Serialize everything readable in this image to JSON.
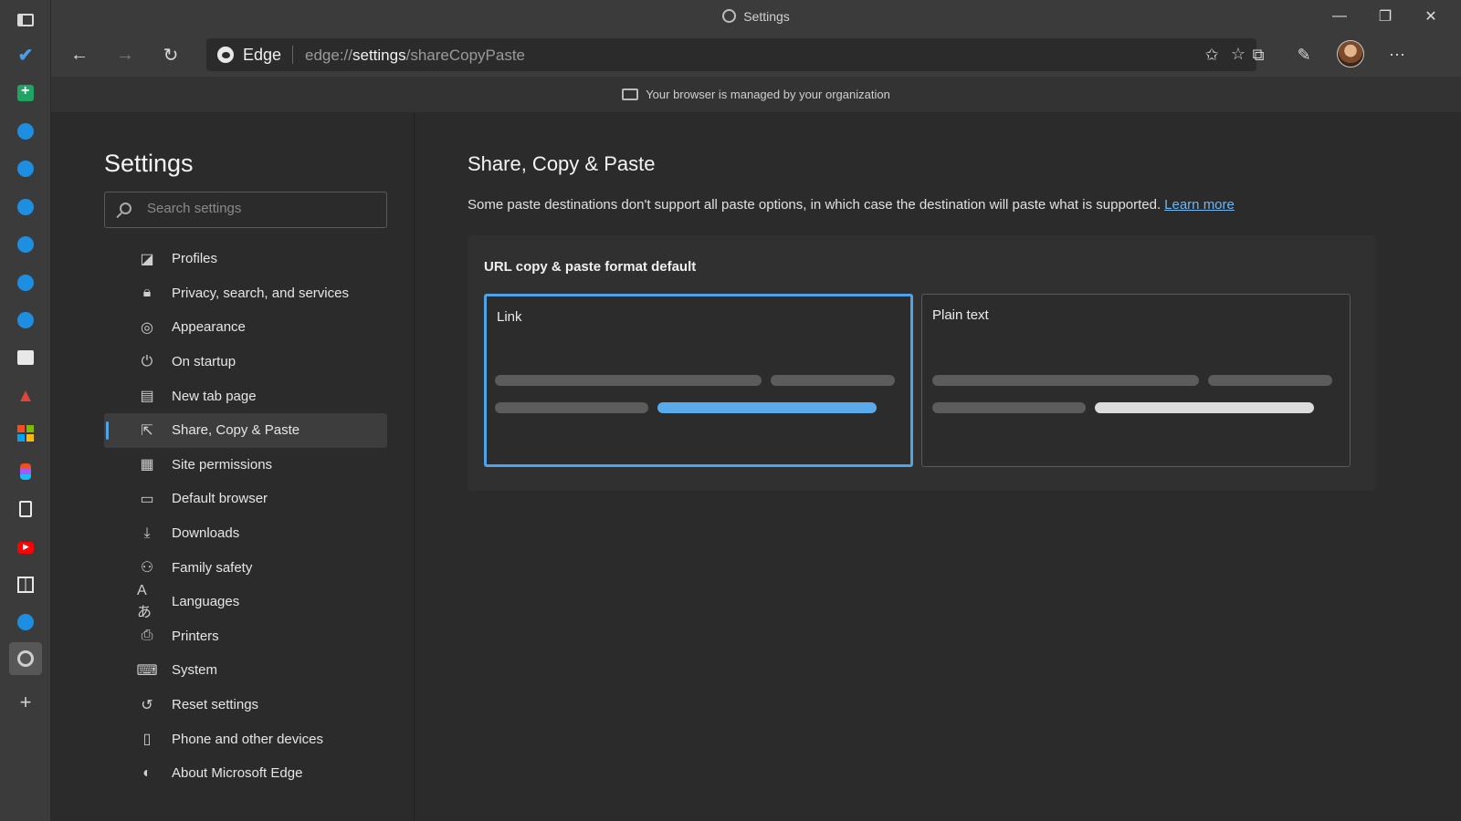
{
  "window": {
    "title": "Settings",
    "controls": [
      "minimize",
      "restore",
      "close"
    ]
  },
  "vertical_tabs": [
    {
      "icon": "tab-panel-icon",
      "color": "#d9d9d9"
    },
    {
      "icon": "todo-icon",
      "color": "#2f7fd8"
    },
    {
      "icon": "sheets-icon",
      "color": "#1fa463"
    },
    {
      "icon": "edge-tab-icon",
      "color": "#1e8ee0"
    },
    {
      "icon": "edge-tab-icon",
      "color": "#1e8ee0"
    },
    {
      "icon": "edge-tab-icon",
      "color": "#1e8ee0"
    },
    {
      "icon": "edge-tab-icon",
      "color": "#1e8ee0"
    },
    {
      "icon": "edge-tab-icon",
      "color": "#1e8ee0"
    },
    {
      "icon": "edge-tab-icon",
      "color": "#1e8ee0"
    },
    {
      "icon": "book-icon",
      "color": "#e8e8e8"
    },
    {
      "icon": "triangle-app-icon",
      "color": "#e0443a"
    },
    {
      "icon": "microsoft-logo-icon",
      "color": "#f25022"
    },
    {
      "icon": "figma-icon",
      "color": "#a259ff"
    },
    {
      "icon": "document-icon",
      "color": "#e8e8e8"
    },
    {
      "icon": "youtube-icon",
      "color": "#ff0000"
    },
    {
      "icon": "dashboard-icon",
      "color": "#e8e8e8"
    },
    {
      "icon": "edge-tab-icon",
      "color": "#1e8ee0"
    },
    {
      "icon": "settings-tab-icon",
      "color": "#cfcfcf",
      "active": true
    },
    {
      "icon": "new-tab-plus-icon",
      "color": "#cfcfcf"
    }
  ],
  "address_bar": {
    "brand": "Edge",
    "url_prefix": "edge://",
    "url_host": "settings",
    "url_path": "/shareCopyPaste"
  },
  "managed_banner": "Your browser is managed by your organization",
  "nav": {
    "title": "Settings",
    "search_placeholder": "Search settings",
    "items": [
      {
        "label": "Profiles",
        "icon": "profile-icon"
      },
      {
        "label": "Privacy, search, and services",
        "icon": "lock-icon"
      },
      {
        "label": "Appearance",
        "icon": "palette-icon"
      },
      {
        "label": "On startup",
        "icon": "power-icon"
      },
      {
        "label": "New tab page",
        "icon": "new-tab-page-icon"
      },
      {
        "label": "Share, Copy & Paste",
        "icon": "share-icon",
        "selected": true
      },
      {
        "label": "Site permissions",
        "icon": "site-permissions-icon"
      },
      {
        "label": "Default browser",
        "icon": "browser-window-icon"
      },
      {
        "label": "Downloads",
        "icon": "download-icon"
      },
      {
        "label": "Family safety",
        "icon": "family-icon"
      },
      {
        "label": "Languages",
        "icon": "languages-icon"
      },
      {
        "label": "Printers",
        "icon": "printer-icon"
      },
      {
        "label": "System",
        "icon": "laptop-icon"
      },
      {
        "label": "Reset settings",
        "icon": "reset-icon"
      },
      {
        "label": "Phone and other devices",
        "icon": "phone-icon"
      },
      {
        "label": "About Microsoft Edge",
        "icon": "edge-logo-icon"
      }
    ]
  },
  "main": {
    "heading": "Share, Copy & Paste",
    "description": "Some paste destinations don't support all paste options, in which case the destination will paste what is supported.",
    "learn_more": "Learn more",
    "panel_title": "URL copy & paste format default",
    "options": [
      {
        "label": "Link",
        "selected": true,
        "accent": "#4fa3e8"
      },
      {
        "label": "Plain text",
        "selected": false,
        "accent": "#dcdcdc"
      }
    ]
  }
}
